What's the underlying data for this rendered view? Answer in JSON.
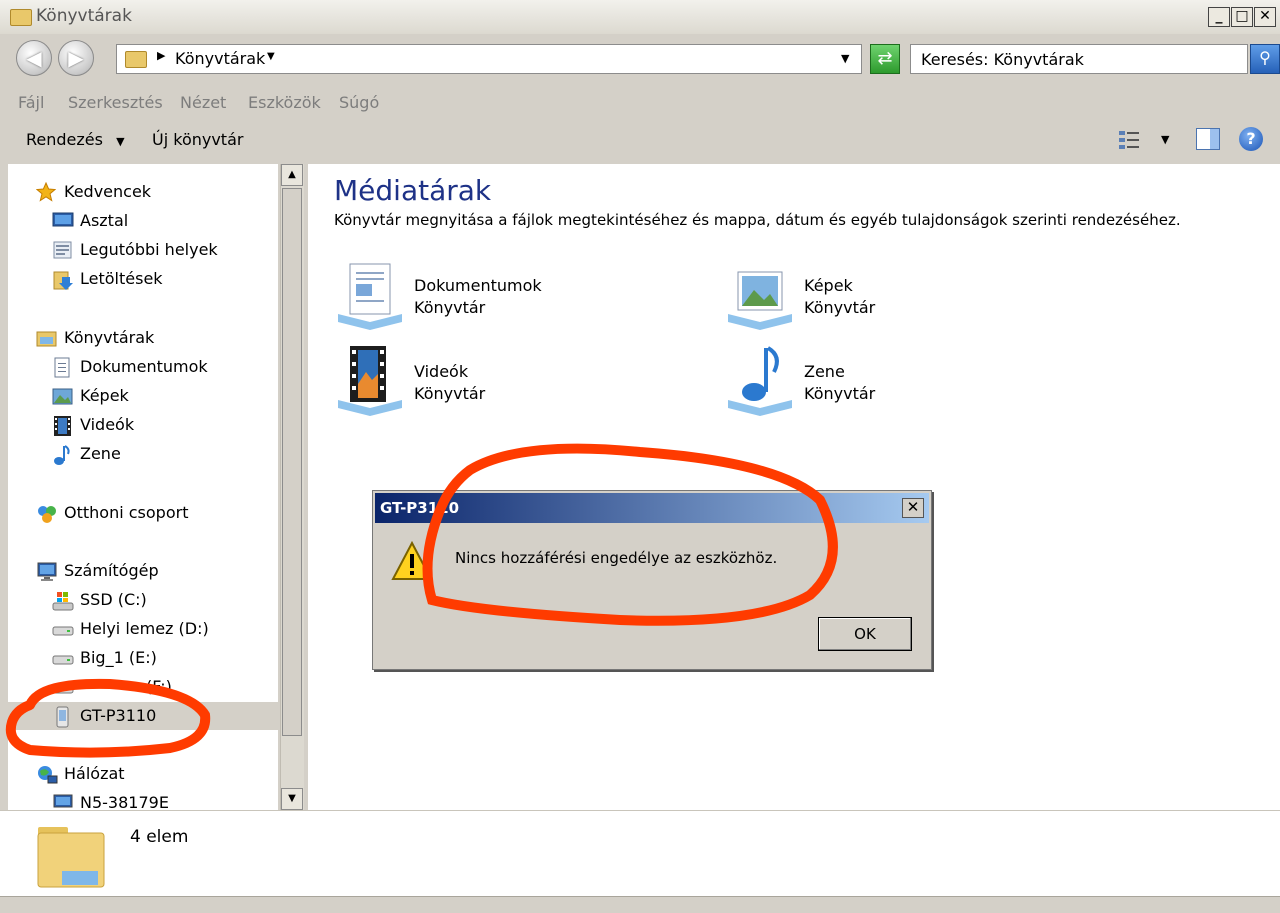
{
  "window": {
    "title": "Könyvtárak"
  },
  "address": {
    "crumb": "Könyvtárak",
    "search_placeholder": "Keresés: Könyvtárak"
  },
  "menu": [
    "Fájl",
    "Szerkesztés",
    "Nézet",
    "Eszközök",
    "Súgó"
  ],
  "toolbar": {
    "organize": "Rendezés",
    "new_library": "Új könyvtár"
  },
  "nav": {
    "favorites": {
      "label": "Kedvencek",
      "items": [
        "Asztal",
        "Legutóbbi helyek",
        "Letöltések"
      ]
    },
    "libraries": {
      "label": "Könyvtárak",
      "items": [
        "Dokumentumok",
        "Képek",
        "Videók",
        "Zene"
      ]
    },
    "homegroup": "Otthoni csoport",
    "computer": {
      "label": "Számítógép",
      "items": [
        "SSD (C:)",
        "Helyi lemez (D:)",
        "Big_1 (E:)",
        "(F:)",
        "GT-P3110"
      ]
    },
    "network": {
      "label": "Hálózat",
      "items": [
        "N5-38179E"
      ]
    }
  },
  "content": {
    "heading": "Médiatárak",
    "description": "Könyvtár megnyitása a fájlok megtekintéséhez és mappa, dátum és egyéb tulajdonságok szerinti rendezéséhez.",
    "libraries": [
      {
        "name": "Dokumentumok",
        "type": "Könyvtár",
        "icon": "documents-library-icon"
      },
      {
        "name": "Képek",
        "type": "Könyvtár",
        "icon": "pictures-library-icon"
      },
      {
        "name": "Videók",
        "type": "Könyvtár",
        "icon": "videos-library-icon"
      },
      {
        "name": "Zene",
        "type": "Könyvtár",
        "icon": "music-library-icon"
      }
    ]
  },
  "status": {
    "count": "4 elem"
  },
  "dialog": {
    "title": "GT-P3110",
    "message": "Nincs hozzáférési engedélye az eszközhöz.",
    "ok": "OK"
  },
  "colors": {
    "annotation": "#ff3b00",
    "dialog_title_start": "#0a246a",
    "dialog_title_end": "#a6caf0",
    "selection": "#d4d0c8"
  }
}
